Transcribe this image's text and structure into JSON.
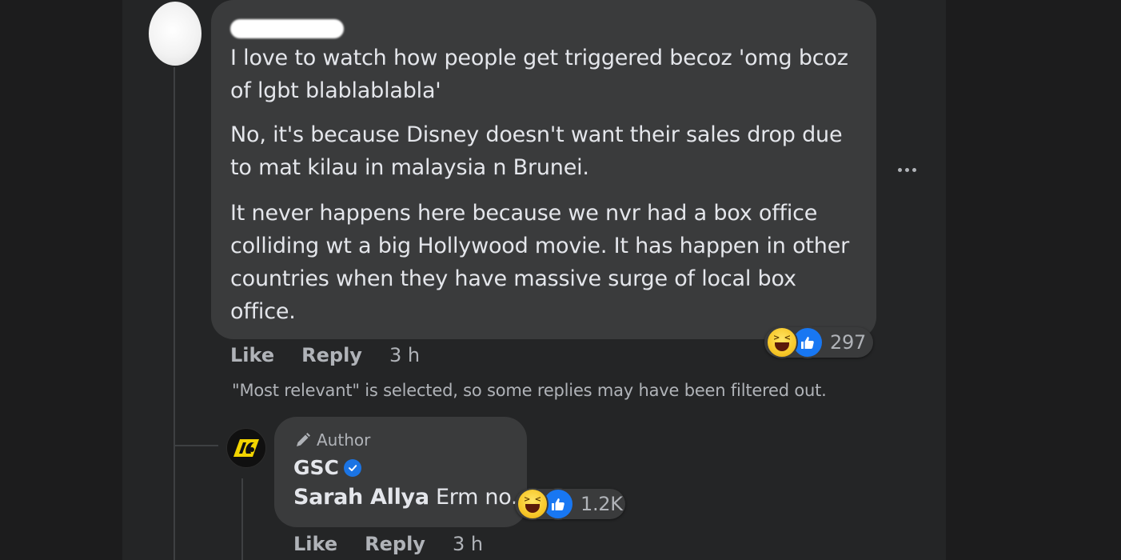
{
  "comment": {
    "paragraphs": [
      "I love to watch how people get triggered becoz 'omg bcoz of lgbt blablablabla'",
      "No, it's because Disney doesn't want their sales drop due to mat kilau in malaysia n Brunei.",
      "It never happens here because we nvr had a box office colliding wt a big Hollywood movie. It has happen in other countries when they have massive surge of local box office."
    ],
    "reaction_icons": [
      "haha-icon",
      "like-icon"
    ],
    "reaction_count": "297",
    "like_label": "Like",
    "reply_label": "Reply",
    "time": "3 h",
    "more_icon": "more-horizontal-icon"
  },
  "filter_notice": "\"Most relevant\" is selected, so some replies may have been filtered out.",
  "reply": {
    "badge_icon": "pencil-icon",
    "badge_label": "Author",
    "author_name": "GSC",
    "verified_icon": "verified-badge-icon",
    "mention": "Sarah Allya",
    "text": "Erm no.",
    "reaction_icons": [
      "haha-icon",
      "like-icon"
    ],
    "reaction_count": "1.2K",
    "like_label": "Like",
    "reply_label": "Reply",
    "time": "3 h"
  },
  "colors": {
    "page_bg": "#1c1c1d",
    "panel_bg": "#242526",
    "bubble_bg": "#3a3b3c",
    "primary_text": "#e4e6eb",
    "secondary_text": "#b0b3b8",
    "like_blue": "#1877f2",
    "haha_yellow": "#f7c82a"
  }
}
